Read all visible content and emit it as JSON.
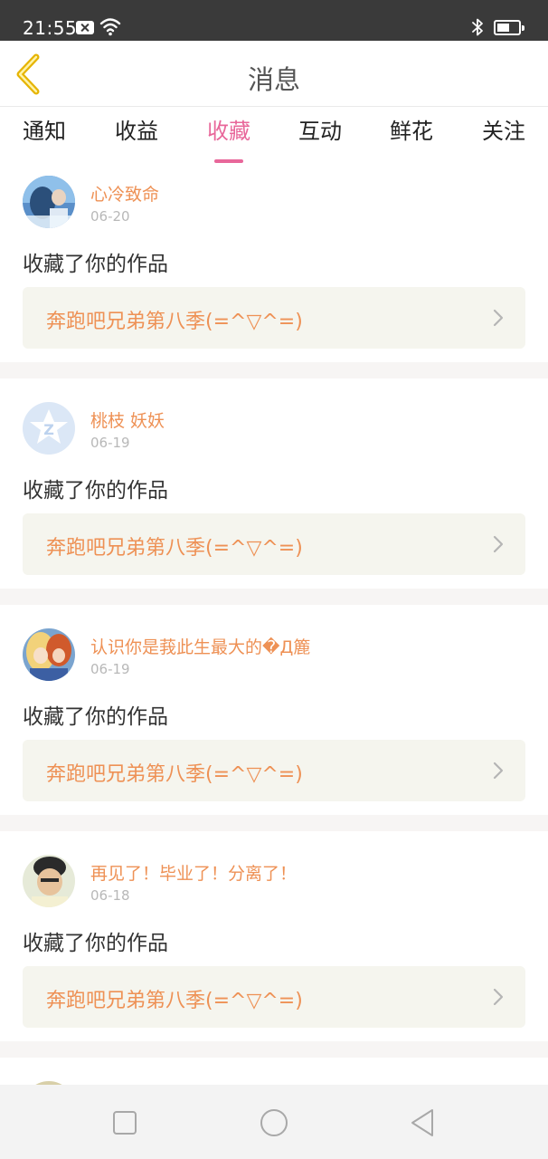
{
  "status_bar": {
    "time": "21:55"
  },
  "header": {
    "title": "消息"
  },
  "tabs": [
    {
      "label": "通知"
    },
    {
      "label": "收益"
    },
    {
      "label": "收藏"
    },
    {
      "label": "互动"
    },
    {
      "label": "鲜花"
    },
    {
      "label": "关注"
    }
  ],
  "active_tab": "收藏",
  "messages": [
    {
      "user": "心冷致命",
      "date": "06-20",
      "action": "收藏了你的作品",
      "work": "奔跑吧兄弟第八季(=^▽^=)"
    },
    {
      "user": "桃枝 妖妖",
      "date": "06-19",
      "action": "收藏了你的作品",
      "work": "奔跑吧兄弟第八季(=^▽^=)"
    },
    {
      "user": "认识你是莪此生最大的�Д簏",
      "date": "06-19",
      "action": "收藏了你的作品",
      "work": "奔跑吧兄弟第八季(=^▽^=)"
    },
    {
      "user": "再见了！毕业了！分离了！",
      "date": "06-18",
      "action": "收藏了你的作品",
      "work": "奔跑吧兄弟第八季(=^▽^=)"
    }
  ],
  "colors": {
    "accent_pink": "#e8679a",
    "name_orange": "#ee9155",
    "back_arrow": "#e6b400"
  }
}
